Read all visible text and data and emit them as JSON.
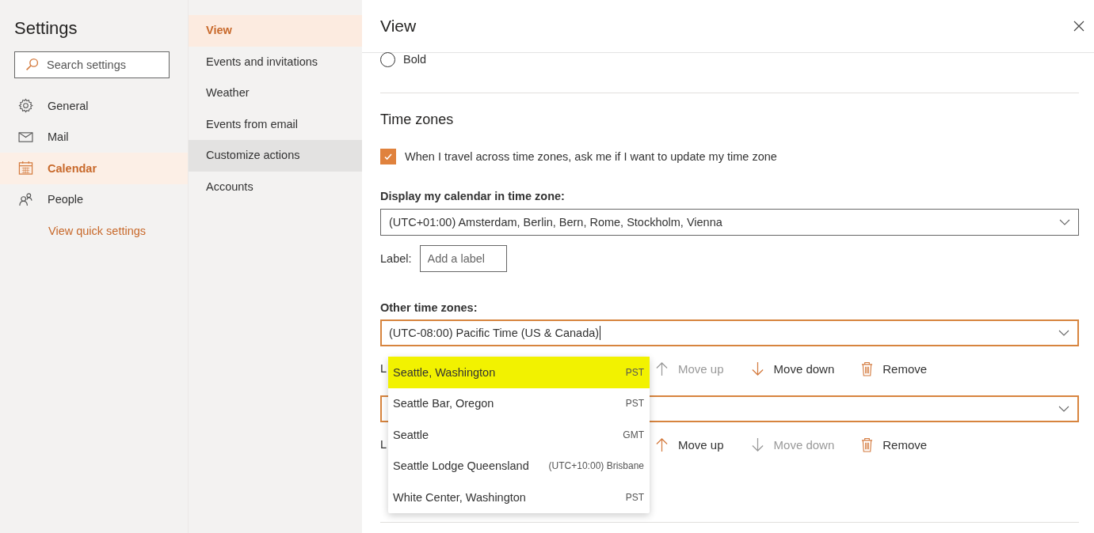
{
  "sidebar": {
    "title": "Settings",
    "search": {
      "placeholder": "Search settings"
    },
    "items": [
      {
        "label": "General",
        "kind": "gear",
        "selected": false
      },
      {
        "label": "Mail",
        "kind": "mail",
        "selected": false
      },
      {
        "label": "Calendar",
        "kind": "calendar",
        "selected": true
      },
      {
        "label": "People",
        "kind": "people",
        "selected": false
      }
    ],
    "link": "View quick settings"
  },
  "subnav": {
    "items": [
      {
        "label": "View",
        "selected": true,
        "hovered": false
      },
      {
        "label": "Events and invitations",
        "selected": false,
        "hovered": false
      },
      {
        "label": "Weather",
        "selected": false,
        "hovered": false
      },
      {
        "label": "Events from email",
        "selected": false,
        "hovered": false
      },
      {
        "label": "Customize actions",
        "selected": false,
        "hovered": true
      },
      {
        "label": "Accounts",
        "selected": false,
        "hovered": false
      }
    ]
  },
  "panel": {
    "title": "View",
    "font_option": {
      "label": "Bold",
      "selected": false
    },
    "section_title": "Time zones",
    "travel_prompt": {
      "label": "When I travel across time zones, ask me if I want to update my time zone",
      "checked": true
    },
    "calendar_zone": {
      "label": "Display my calendar in time zone:",
      "value": "(UTC+01:00) Amsterdam, Berlin, Bern, Rome, Stockholm, Vienna",
      "label_caption": "Label:",
      "label_placeholder": "Add a label"
    },
    "other_zones": {
      "label": "Other time zones:",
      "entries": [
        {
          "value": "(UTC-08:00) Pacific Time (US & Canada)",
          "focused": true,
          "label_caption": "L",
          "actions": [
            {
              "kind": "up",
              "label": "Move up",
              "disabled": true
            },
            {
              "kind": "down",
              "label": "Move down",
              "disabled": false
            },
            {
              "kind": "remove",
              "label": "Remove",
              "disabled": false
            }
          ]
        },
        {
          "focused": false,
          "label_caption": "L",
          "actions": [
            {
              "kind": "up",
              "label": "Move up",
              "disabled": false
            },
            {
              "kind": "down",
              "label": "Move down",
              "disabled": true
            },
            {
              "kind": "remove",
              "label": "Remove",
              "disabled": false
            }
          ]
        }
      ]
    },
    "suggestions": [
      {
        "name": "Seattle, Washington",
        "zone": "PST",
        "highlighted": true
      },
      {
        "name": "Seattle Bar, Oregon",
        "zone": "PST",
        "highlighted": false
      },
      {
        "name": "Seattle",
        "zone": "GMT",
        "highlighted": false
      },
      {
        "name": "Seattle Lodge Queensland",
        "zone": "(UTC+10:00) Brisbane",
        "highlighted": false
      },
      {
        "name": "White Center, Washington",
        "zone": "PST",
        "highlighted": false
      }
    ]
  }
}
